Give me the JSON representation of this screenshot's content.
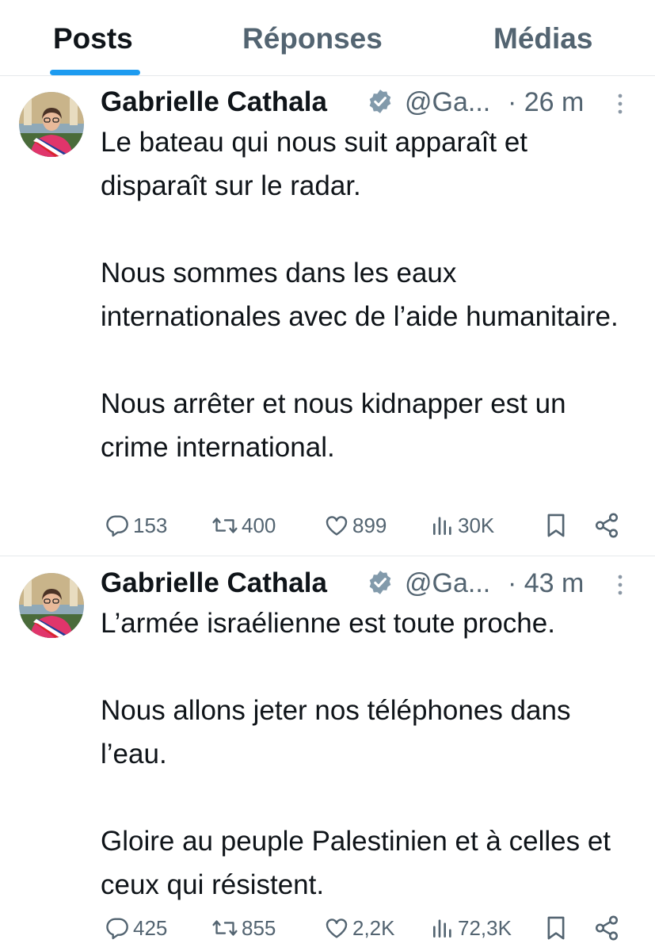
{
  "tabs": [
    {
      "label": "Posts",
      "active": true
    },
    {
      "label": "Réponses",
      "active": false
    },
    {
      "label": "Médias",
      "active": false
    }
  ],
  "colors": {
    "accent": "#1d9bf0",
    "text_primary": "#0f1419",
    "text_secondary": "#536471",
    "divider": "#e6e9ec",
    "verified_badge": "#829aab"
  },
  "posts": [
    {
      "author": "Gabrielle Cathala",
      "handle": "@Ga...",
      "time": "· 26 m",
      "paragraphs": [
        "Le bateau qui nous suit apparaît et disparaît sur le radar.",
        "Nous sommes dans les eaux internationales avec de l’aide humanitaire.",
        "Nous arrêter et nous kidnapper est un crime international."
      ],
      "replies": "153",
      "reposts": "400",
      "likes": "899",
      "views": "30K"
    },
    {
      "author": "Gabrielle Cathala",
      "handle": "@Ga...",
      "time": "· 43 m",
      "paragraphs": [
        "L’armée israélienne est toute proche.",
        "Nous allons jeter nos téléphones dans l’eau.",
        "Gloire au peuple Palestinien et à celles et ceux qui résistent."
      ],
      "replies": "425",
      "reposts": "855",
      "likes": "2,2K",
      "views": "72,3K"
    }
  ],
  "icons": {
    "verified": "verified-badge-icon",
    "more": "more-vertical-icon",
    "reply": "reply-icon",
    "repost": "repost-icon",
    "like": "heart-icon",
    "views": "views-chart-icon",
    "bookmark": "bookmark-icon",
    "share": "share-icon"
  }
}
